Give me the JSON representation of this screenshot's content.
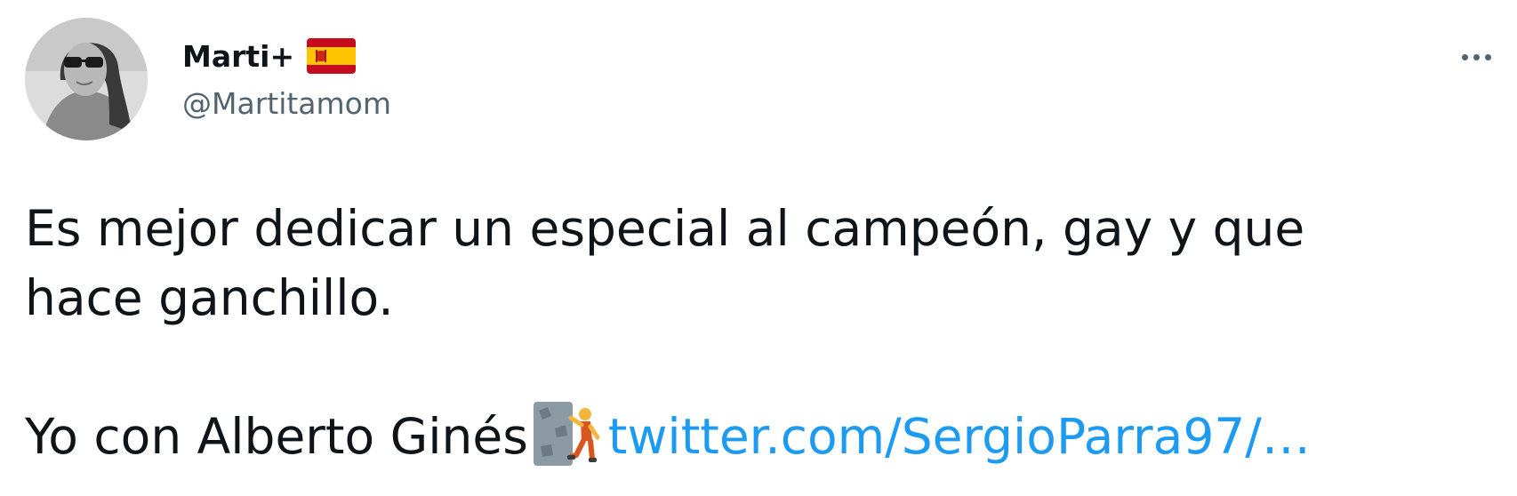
{
  "tweet": {
    "author": {
      "display_name": "Marti+",
      "handle": "@Martitamom",
      "avatar_icon": "profile-photo",
      "flag_icon": "spain-flag-icon"
    },
    "more_icon": "more-dots-icon",
    "text_line_1": "Es mejor dedicar un especial al campeón, gay y que",
    "text_line_2": "hace ganchillo.",
    "text_line_3": "Yo con Alberto Ginés",
    "emoji_icon": "person-climbing-icon",
    "link_text": "twitter.com/SergioParra97/…"
  },
  "colors": {
    "text": "#0f1419",
    "secondary": "#536471",
    "link": "#1d9bf0"
  }
}
